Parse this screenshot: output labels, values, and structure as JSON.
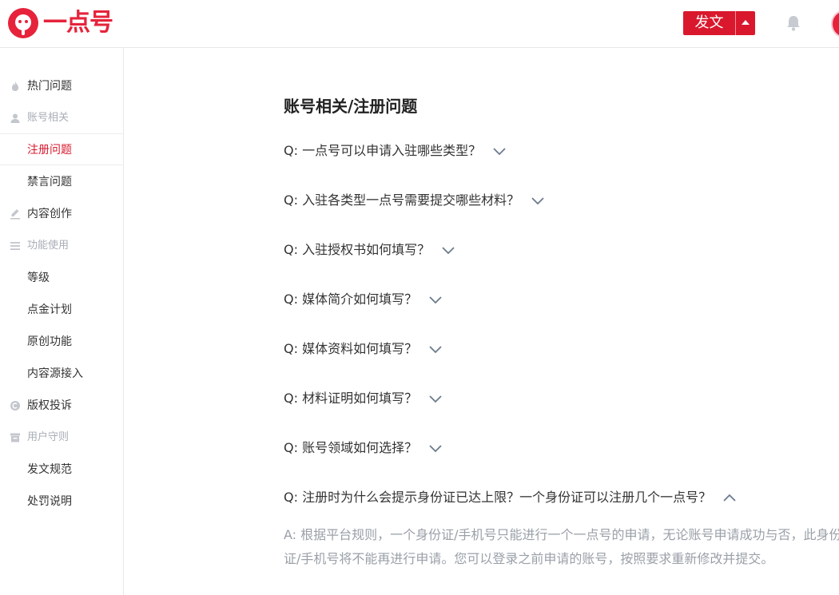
{
  "header": {
    "logo_text": "一点号",
    "publish_label": "发文"
  },
  "sidebar": {
    "items": [
      {
        "label": "热门问题",
        "type": "item",
        "icon": "fire-icon"
      },
      {
        "label": "账号相关",
        "type": "group",
        "icon": "user-icon"
      },
      {
        "label": "注册问题",
        "type": "item",
        "active": true
      },
      {
        "label": "禁言问题",
        "type": "item"
      },
      {
        "label": "内容创作",
        "type": "item",
        "icon": "pen-icon"
      },
      {
        "label": "功能使用",
        "type": "group",
        "icon": "menu-icon"
      },
      {
        "label": "等级",
        "type": "item"
      },
      {
        "label": "点金计划",
        "type": "item"
      },
      {
        "label": "原创功能",
        "type": "item"
      },
      {
        "label": "内容源接入",
        "type": "item"
      },
      {
        "label": "版权投诉",
        "type": "item",
        "icon": "copyright-icon"
      },
      {
        "label": "用户守则",
        "type": "group",
        "icon": "rules-icon"
      },
      {
        "label": "发文规范",
        "type": "item"
      },
      {
        "label": "处罚说明",
        "type": "item"
      }
    ]
  },
  "main": {
    "title": "账号相关/注册问题",
    "faqs": [
      {
        "question": "Q: 一点号可以申请入驻哪些类型？",
        "expanded": false
      },
      {
        "question": "Q: 入驻各类型一点号需要提交哪些材料？",
        "expanded": false
      },
      {
        "question": "Q: 入驻授权书如何填写？",
        "expanded": false
      },
      {
        "question": "Q: 媒体简介如何填写？",
        "expanded": false
      },
      {
        "question": "Q: 媒体资料如何填写？",
        "expanded": false
      },
      {
        "question": "Q: 材料证明如何填写？",
        "expanded": false
      },
      {
        "question": "Q: 账号领域如何选择？",
        "expanded": false
      },
      {
        "question": "Q: 注册时为什么会提示身份证已达上限？一个身份证可以注册几个一点号？",
        "expanded": true
      }
    ],
    "answer": "A: 根据平台规则，一个身份证/手机号只能进行一个一点号的申请，无论账号申请成功与否，此身份证/手机号将不能再进行申请。您可以登录之前申请的账号，按照要求重新修改并提交。"
  },
  "colors": {
    "brand": "#e6233b",
    "accent": "#d9182d",
    "muted": "#9aa0a8"
  }
}
